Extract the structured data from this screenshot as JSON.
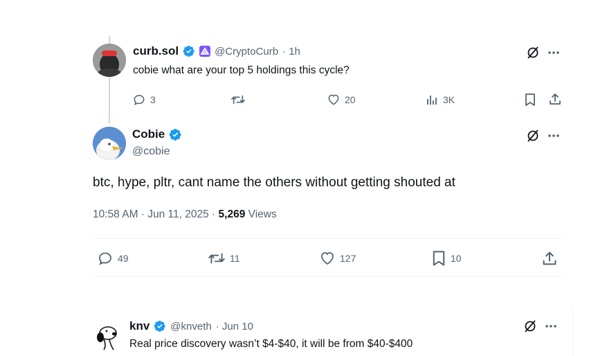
{
  "reply_parent": {
    "display_name": "curb.sol",
    "handle": "@CryptoCurb",
    "time": "· 1h",
    "text": "cobie what are your top 5 holdings this cycle?",
    "actions": {
      "replies": "3",
      "retweets": "",
      "likes": "20",
      "views": "3K"
    }
  },
  "main_tweet": {
    "display_name": "Cobie",
    "handle": "@cobie",
    "text": "btc, hype, pltr, cant name the others without getting shouted at",
    "timestamp": "10:58 AM · Jun 11, 2025 · ",
    "view_count": "5,269",
    "views_label": " Views",
    "actions": {
      "replies": "49",
      "retweets": "11",
      "likes": "127",
      "bookmarks": "10"
    }
  },
  "reply": {
    "display_name": "knv",
    "handle": "@knveth",
    "time": "· Jun 10",
    "text": "Real price discovery wasn’t $4-$40, it will be from $40-$400"
  },
  "colors": {
    "verified": "#1d9bf0",
    "muted": "#536471",
    "text": "#0f1419",
    "divider": "#eff3f4"
  },
  "icons": [
    "reply-icon",
    "retweet-icon",
    "like-icon",
    "views-icon",
    "bookmark-icon",
    "share-icon",
    "grok-icon",
    "more-icon",
    "verified-badge-icon",
    "affiliate-badge-icon"
  ]
}
